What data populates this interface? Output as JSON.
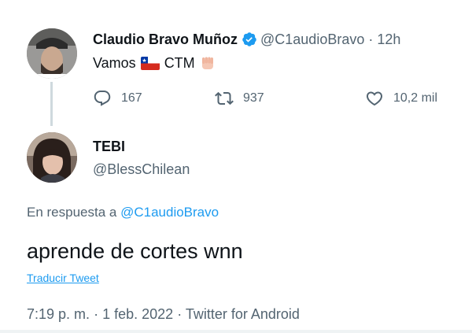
{
  "parent_tweet": {
    "display_name": "Claudio Bravo Muñoz",
    "handle": "@C1audioBravo",
    "separator": "·",
    "time": "12h",
    "text_before_flag": "Vamos",
    "text_after_flag": "CTM",
    "flag_icon": "chile-flag-icon",
    "emoji_icon": "raised-fist-icon",
    "reply_count": "167",
    "retweet_count": "937",
    "like_count": "10,2 mil"
  },
  "reply_tweet": {
    "display_name": "TEBI",
    "handle": "@BlessChilean",
    "in_reply_prefix": "En respuesta a",
    "in_reply_mention": "@C1audioBravo",
    "text": "aprende de cortes wnn",
    "translate_label": "Traducir Tweet",
    "time": "7:19 p. m.",
    "separator": "·",
    "date": "1 feb. 2022",
    "source": "Twitter for Android"
  },
  "colors": {
    "accent": "#1d9bf0",
    "secondary_text": "#536471",
    "primary_text": "#0f1419",
    "thread_line": "#cfd9de"
  }
}
